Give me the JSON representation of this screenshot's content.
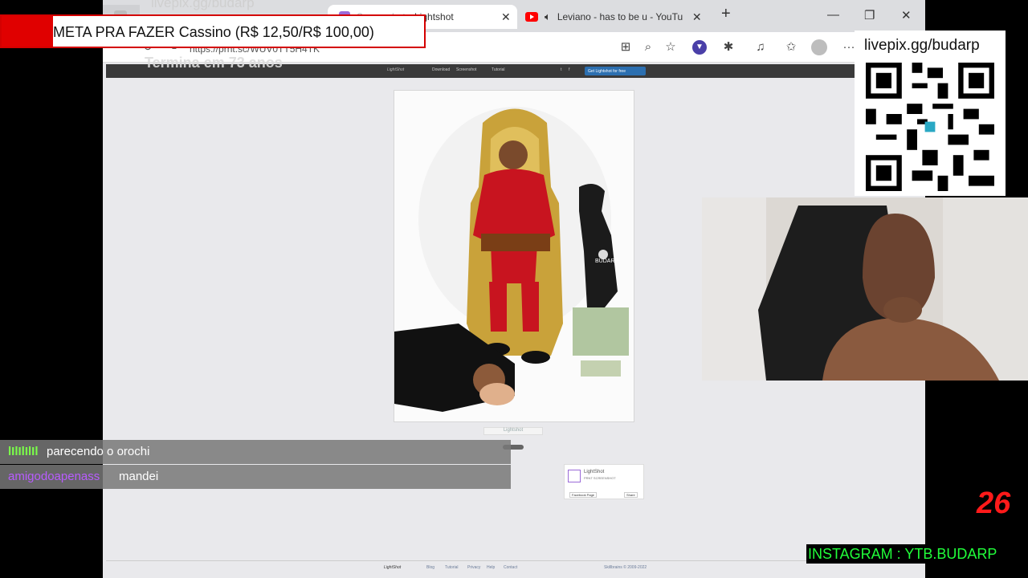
{
  "browser": {
    "tabs": [
      {
        "title": "Lightshot",
        "prefix": "Screenshot - "
      },
      {
        "title": "Leviano - has to be u - YouTu"
      }
    ],
    "new_tab_symbol": "+",
    "close_symbol": "✕",
    "window_controls": {
      "minimize": "—",
      "restore": "❐",
      "close": "✕"
    },
    "url": "https://prnt.sc/WUV0TT5H4TK",
    "menu_symbol": "···"
  },
  "site": {
    "logo": "LightShot",
    "nav": [
      "Download",
      "Screenshot",
      "Tutorial"
    ],
    "nav_button": "Get Lightshot for free",
    "below_image_button": "Lightshot",
    "share_box": {
      "title": "LightShot",
      "subtitle": "PRNT SCREENSHOT",
      "like": "Facebook Page",
      "share": "Share"
    },
    "footer": {
      "logo": "LightShot",
      "links": [
        "Blog",
        "Tutorial",
        "Privacy",
        "Help",
        "Contact"
      ],
      "copyright": "Skillbrains © 2009-2022"
    },
    "photo_label": "BUDARP"
  },
  "overlays": {
    "goal_banner": "META PRA FAZER Cassino (R$ 12,50/R$ 100,00)",
    "goal_ghost": "livepix.gg/budarp",
    "timer_ghost": "Termina em 73 anos",
    "qr_label": "livepix.gg/budarp",
    "counter": "26",
    "instagram": "INSTAGRAM : YTB.BUDARP",
    "chat": [
      {
        "user": "lIlIlIlIl",
        "user_color": "#7bff4a",
        "message": "parecendo o orochi"
      },
      {
        "user": "amigodoapenass",
        "user_color": "#b85cff",
        "message": "mandei"
      }
    ]
  },
  "colors": {
    "accent_red": "#e00000",
    "insta_green": "#21ff3a",
    "counter_red": "#ff1a1a"
  }
}
